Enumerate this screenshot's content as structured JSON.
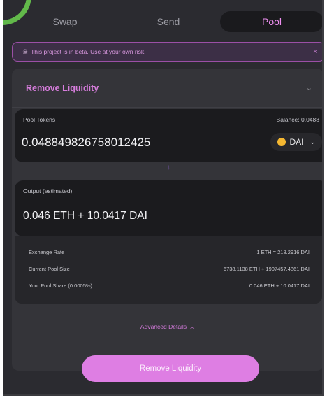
{
  "tabs": [
    {
      "label": "Swap",
      "active": false
    },
    {
      "label": "Send",
      "active": false
    },
    {
      "label": "Pool",
      "active": true
    }
  ],
  "beta_banner": {
    "icon": "skull-icon",
    "text": "This project is in beta. Use at your own risk.",
    "close": "×"
  },
  "action_dropdown": {
    "label": "Remove Liquidity",
    "icon": "chevron-down-icon"
  },
  "pool_tokens": {
    "label": "Pool Tokens",
    "balance": "Balance: 0.0488",
    "amount": "0.048849826758012425",
    "token": "DAI",
    "token_icon": "dai-coin-icon"
  },
  "arrow": "↓",
  "output": {
    "label": "Output (estimated)",
    "value": "0.046 ETH  +  10.0417 DAI"
  },
  "details": [
    {
      "label": "Exchange Rate",
      "value": "1 ETH = 218.2916 DAI"
    },
    {
      "label": "Current Pool Size",
      "value": "6738.1138 ETH + 1907457.4861 DAI"
    },
    {
      "label": "Your Pool Share (0.0005%)",
      "value": "0.046 ETH + 10.0417 DAI"
    }
  ],
  "advanced": {
    "label": "Advanced Details",
    "icon": "chevron-up-icon"
  },
  "primary_button": "Remove Liquidity",
  "colors": {
    "accent": "#de7ee3",
    "background": "#2b2b30",
    "card": "#1b1b1e",
    "banner_border": "#9b4fa6"
  }
}
